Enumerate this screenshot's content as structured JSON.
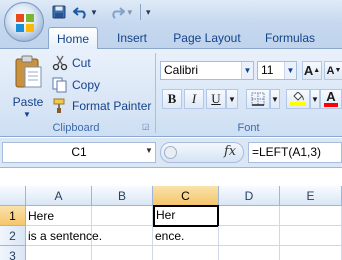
{
  "quick_access": {
    "save_icon": "save-icon",
    "undo_icon": "undo-icon",
    "redo_icon": "redo-icon",
    "customize_icon": "chevron-down-icon"
  },
  "tabs": [
    {
      "label": "Home",
      "active": true
    },
    {
      "label": "Insert",
      "active": false
    },
    {
      "label": "Page Layout",
      "active": false
    },
    {
      "label": "Formulas",
      "active": false
    }
  ],
  "clipboard": {
    "paste_label": "Paste",
    "cut_label": "Cut",
    "copy_label": "Copy",
    "format_painter_label": "Format Painter",
    "group_label": "Clipboard"
  },
  "font": {
    "family": "Calibri",
    "size": "11",
    "group_label": "Font",
    "bold": "B",
    "italic": "I",
    "underline": "U",
    "grow": "A",
    "shrink": "A",
    "font_color_letter": "A",
    "font_color": "#ff0000",
    "fill_color": "#ffff00"
  },
  "formula_bar": {
    "name_box": "C1",
    "fx_label": "fx",
    "formula": "=LEFT(A1,3)"
  },
  "sheet": {
    "columns": [
      "A",
      "B",
      "C",
      "D",
      "E"
    ],
    "selected_column": "C",
    "rows": [
      "1",
      "2",
      "3"
    ],
    "selected_row": "1",
    "cells": {
      "A1": "Here",
      "C1": "Her",
      "A2": "is a sentence.",
      "C2": "ence."
    },
    "active_cell": "C1"
  }
}
